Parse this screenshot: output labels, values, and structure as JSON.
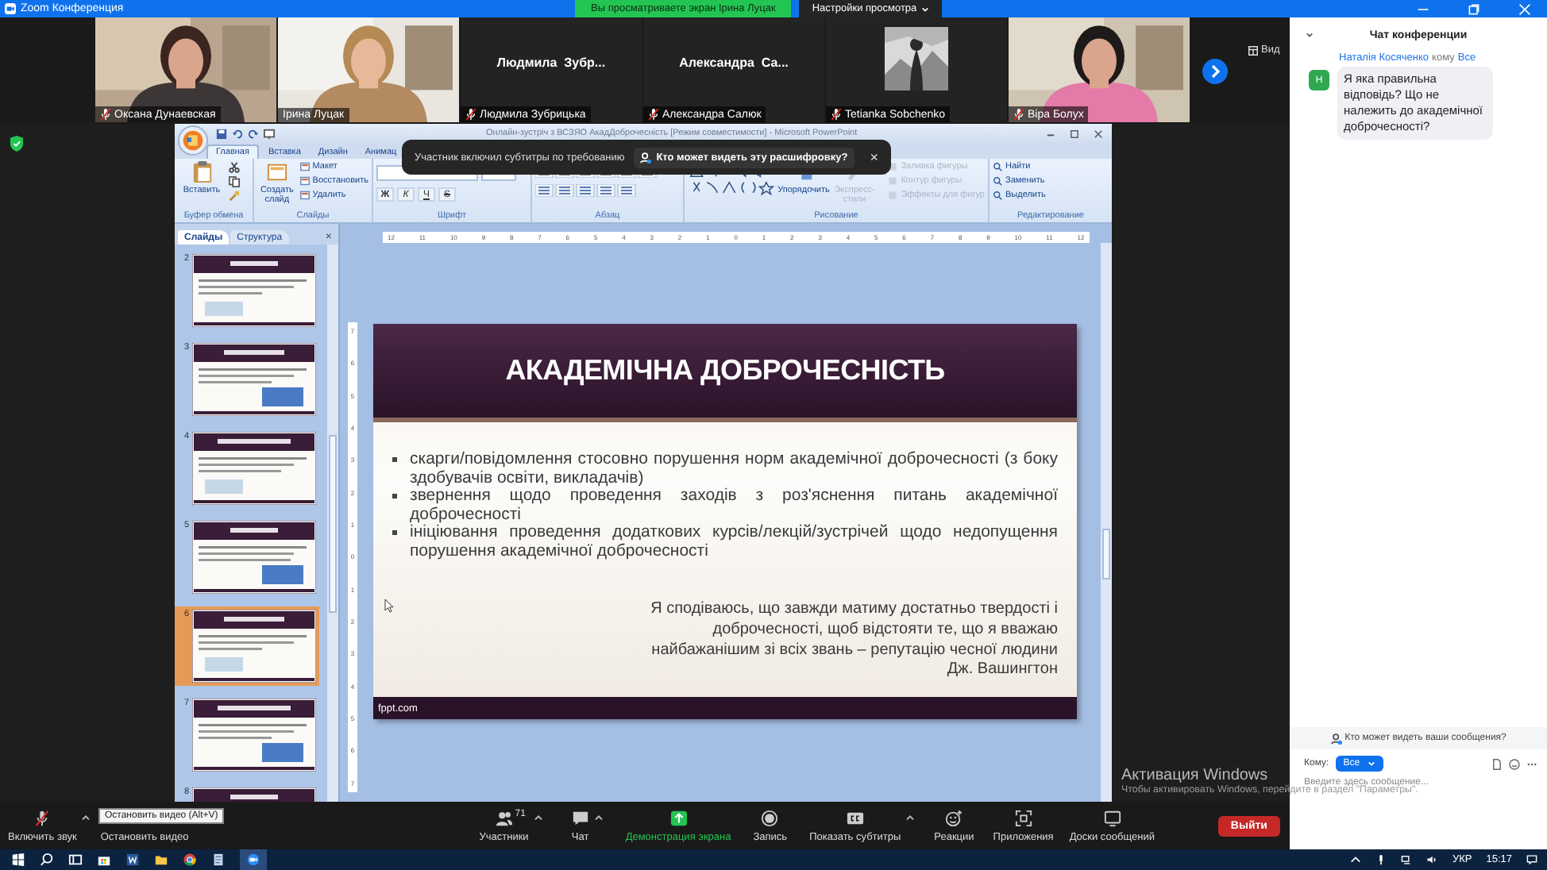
{
  "window": {
    "title": "Zoom Конференция",
    "share_banner": "Вы просматриваете экран Ірина Луцак",
    "view_options": "Настройки просмотра"
  },
  "gallery": {
    "view_label": "Вид",
    "participants": [
      {
        "name": "Оксана Дунаевская",
        "kind": "video",
        "muted": true
      },
      {
        "name": "Ірина Луцак",
        "kind": "video",
        "muted": false
      },
      {
        "name": "Людмила Зубрицька",
        "display": "Людмила  Зубр...",
        "kind": "name",
        "muted": true
      },
      {
        "name": "Александра Салюк",
        "display": "Александра  Са...",
        "kind": "name",
        "muted": true
      },
      {
        "name": "Tetianka Sobchenko",
        "kind": "avatar",
        "muted": true
      },
      {
        "name": "Віра Болух",
        "kind": "video",
        "muted": true
      }
    ]
  },
  "caption_toast": {
    "message": "Участник включил субтитры по требованию",
    "link": "Кто может видеть эту расшифровку?",
    "close": "×"
  },
  "powerpoint": {
    "title": "Онлайн-зустріч з ВСЗЯО АкадДоброчесність [Режим совместимости] - Microsoft PowerPoint",
    "tabs": [
      {
        "label": "Главная",
        "selected": true
      },
      {
        "label": "Вставка",
        "selected": false
      },
      {
        "label": "Дизайн",
        "selected": false
      },
      {
        "label": "Анимац",
        "selected": false
      }
    ],
    "ribbon": {
      "clipboard": {
        "label": "Буфер обмена",
        "paste": "Вставить"
      },
      "slides": {
        "label": "Слайды",
        "new_slide": "Создать слайд",
        "buttons": [
          "Макет",
          "Восстановить",
          "Удалить"
        ]
      },
      "font": {
        "label": "Шрифт",
        "format_buttons": [
          "Ж",
          "К",
          "Ч",
          "S"
        ]
      },
      "paragraph": {
        "label": "Абзац"
      },
      "drawing": {
        "label": "Рисование",
        "arrange": "Упорядочить",
        "quick_styles": "Экспресс-стили",
        "buttons": [
          {
            "label": "Заливка фигуры",
            "disabled": true
          },
          {
            "label": "Контур фигуры",
            "disabled": true
          },
          {
            "label": "Эффекты для фигур",
            "disabled": true
          }
        ]
      },
      "editing": {
        "label": "Редактирование",
        "buttons": [
          "Найти",
          "Заменить",
          "Выделить"
        ]
      }
    },
    "pane_tabs": [
      {
        "label": "Слайды",
        "selected": true
      },
      {
        "label": "Структура",
        "selected": false
      }
    ],
    "pane_close": "×",
    "thumbnails": [
      {
        "number": "2",
        "selected": false
      },
      {
        "number": "3",
        "selected": false
      },
      {
        "number": "4",
        "selected": false
      },
      {
        "number": "5",
        "selected": false
      },
      {
        "number": "6",
        "selected": true
      },
      {
        "number": "7",
        "selected": false
      },
      {
        "number": "8",
        "selected": false
      }
    ],
    "ruler_h": [
      "12",
      "11",
      "10",
      "9",
      "8",
      "7",
      "6",
      "5",
      "4",
      "3",
      "2",
      "1",
      "0",
      "1",
      "2",
      "3",
      "4",
      "5",
      "6",
      "7",
      "8",
      "9",
      "10",
      "11",
      "12"
    ],
    "ruler_v": [
      "7",
      "6",
      "5",
      "4",
      "3",
      "2",
      "1",
      "0",
      "1",
      "2",
      "3",
      "4",
      "5",
      "6",
      "7"
    ],
    "slide": {
      "title": "АКАДЕМІЧНА ДОБРОЧЕСНІСТЬ",
      "bullets": [
        "скарги/повідомлення стосовно порушення норм академічної доброчесності (з боку здобувачів освіти, викладачів)",
        "звернення щодо проведення заходів з роз'яснення питань академічної доброчесності",
        "ініціювання проведення додаткових курсів/лекцій/зустрічей щодо недопущення порушення академічної доброчесності"
      ],
      "quote": "Я сподіваюсь, що завжди матиму достатньо твердості і доброчесності, щоб відстояти те, що я вважаю найбажанішим зі всіх звань – репутацію чесної людини",
      "author": "Дж. Вашингтон",
      "footer": "fppt.com"
    }
  },
  "chat": {
    "title": "Чат конференции",
    "messages": [
      {
        "sender": "Наталія Косяченко",
        "to_word": "кому",
        "recipient": "Все",
        "avatar": "Н",
        "text": "Я яка правильна відповідь? Що не належить до академічної доброчесності?"
      }
    ],
    "privacy": "Кто может видеть ваши сообщения?",
    "to_label": "Кому:",
    "to_value": "Все",
    "placeholder": "Введите здесь сообщение..."
  },
  "toolbar": {
    "tooltip": "Остановить видео (Alt+V)",
    "items": [
      {
        "kind": "mic",
        "label": "Включить звук",
        "caret": true
      },
      {
        "kind": "video",
        "label": "Остановить видео",
        "caret": false
      },
      {
        "kind": "participants",
        "label": "Участники",
        "count": "71",
        "caret": true
      },
      {
        "kind": "chat",
        "label": "Чат",
        "caret": true
      },
      {
        "kind": "share",
        "label": "Демонстрация экрана",
        "caret": false
      },
      {
        "kind": "record",
        "label": "Запись",
        "caret": false
      },
      {
        "kind": "captions",
        "label": "Показать субтитры",
        "caret": true
      },
      {
        "kind": "reactions",
        "label": "Реакции",
        "caret": false
      },
      {
        "kind": "apps",
        "label": "Приложения",
        "caret": false
      },
      {
        "kind": "whiteboards",
        "label": "Доски сообщений",
        "caret": false
      }
    ],
    "leave": "Выйти"
  },
  "activation": {
    "title": "Активация Windows",
    "text": "Чтобы активировать Windows, перейдите в раздел \"Параметры\"."
  },
  "taskbar": {
    "language": "УКР",
    "time": "15:17"
  }
}
